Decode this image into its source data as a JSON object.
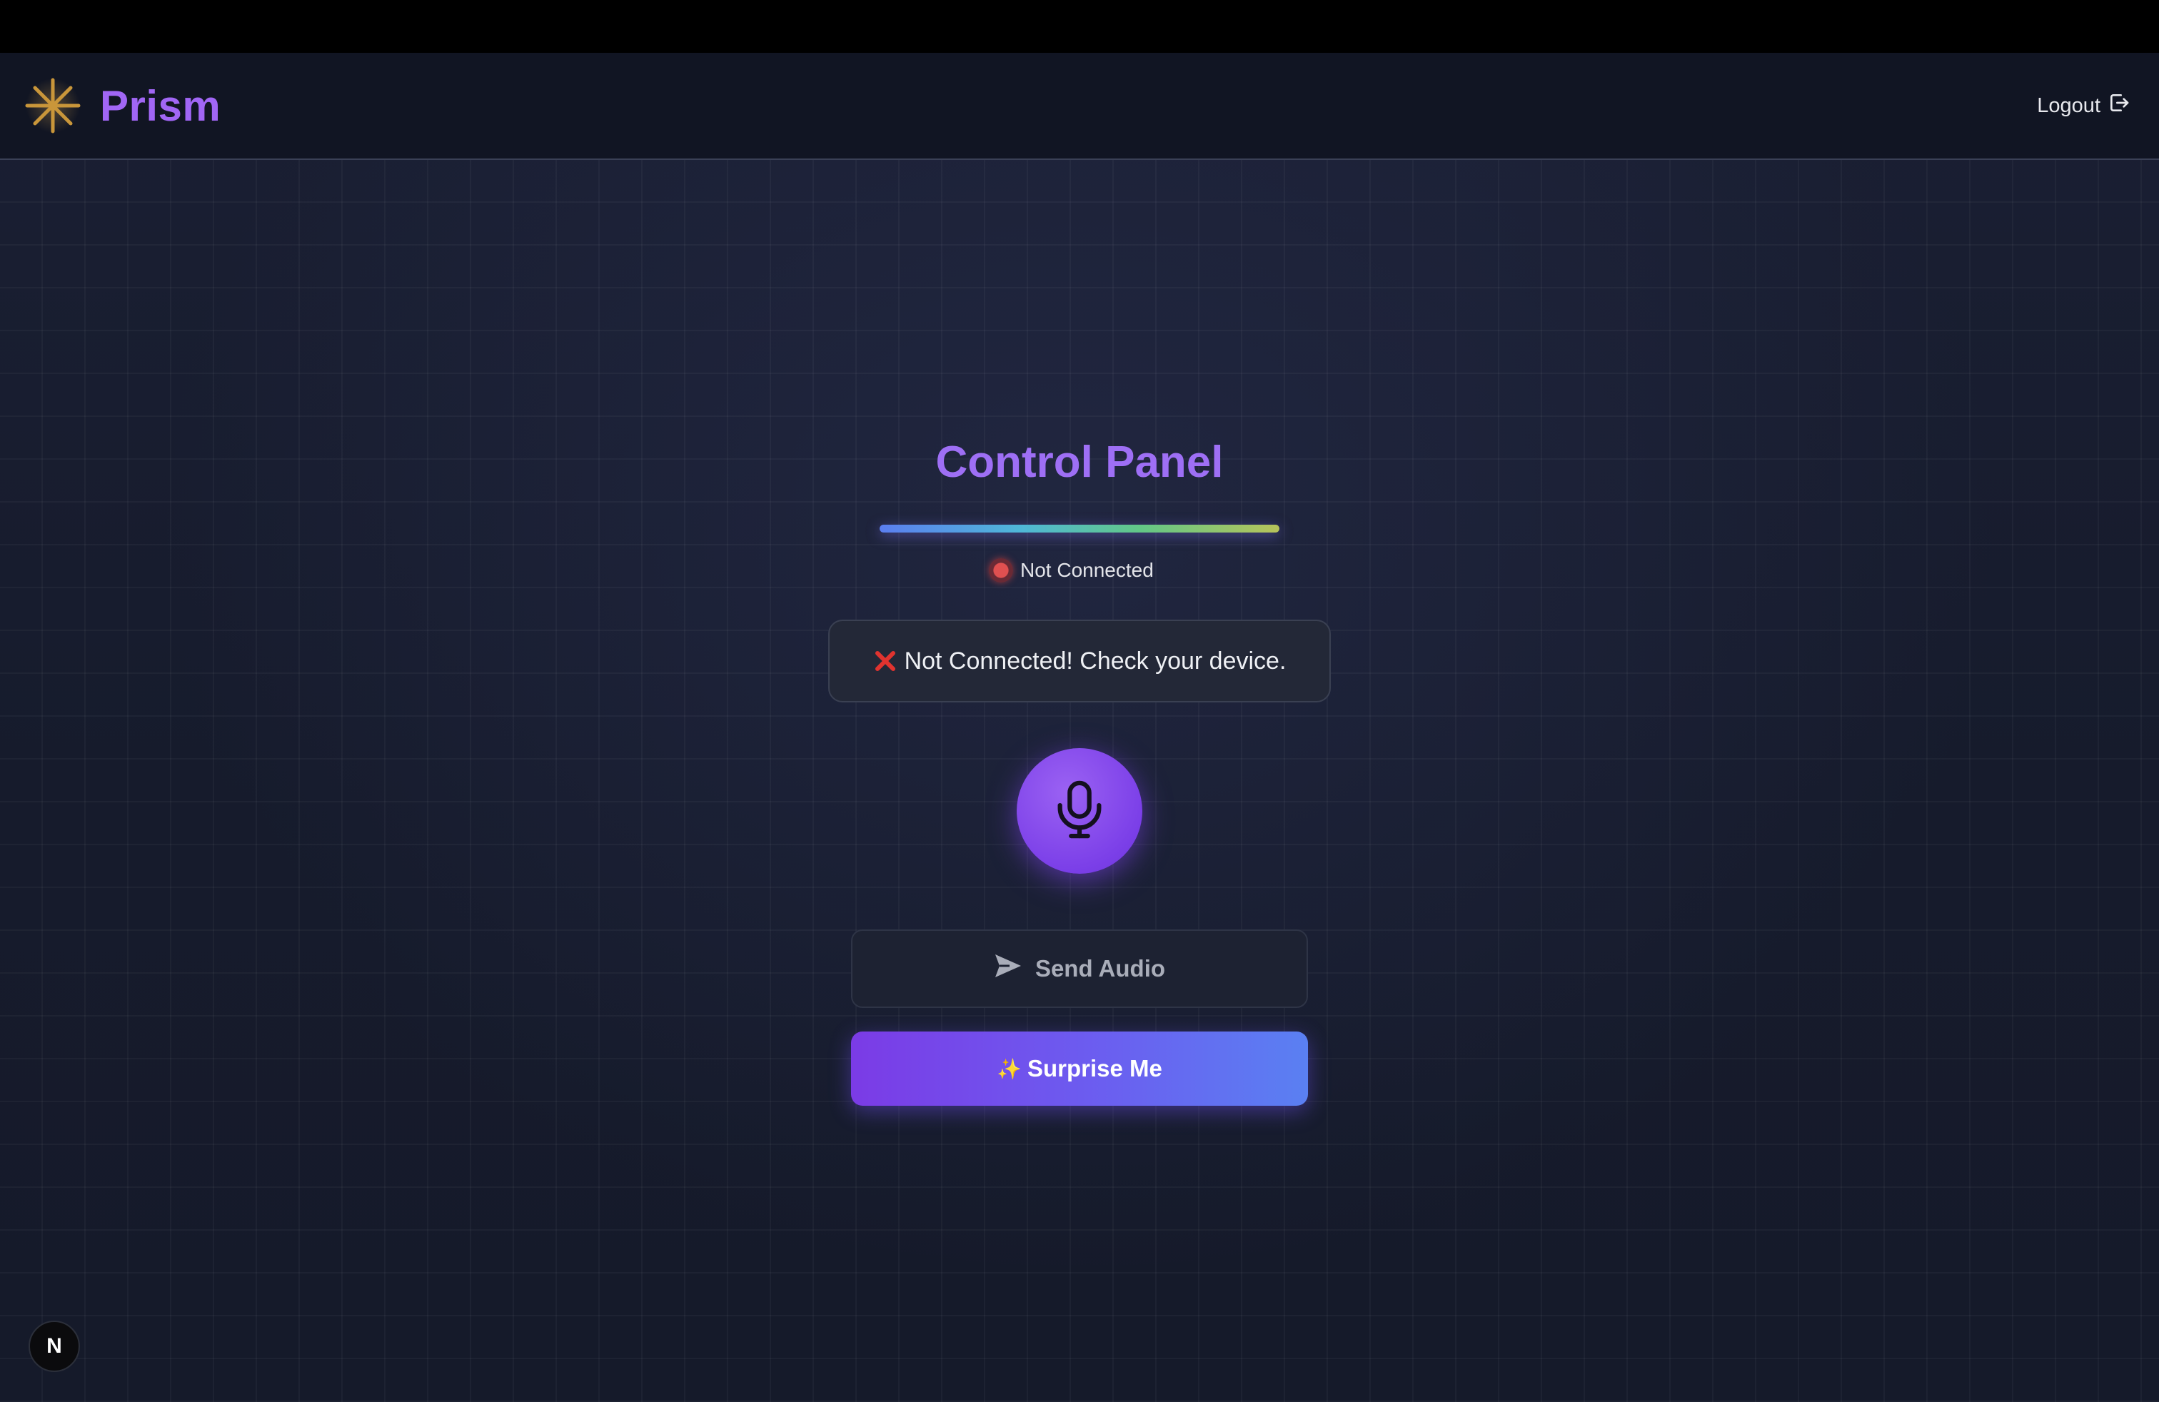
{
  "header": {
    "brand_name": "Prism",
    "logout_label": "Logout"
  },
  "main": {
    "title": "Control Panel",
    "status_text": "Not Connected",
    "alert_text": "Not Connected! Check your device.",
    "send_label": "Send Audio",
    "surprise_label": "Surprise Me"
  },
  "devtools": {
    "badge_letter": "N"
  },
  "icons": {
    "logo": "asterisk-star-icon",
    "logout": "logout-icon",
    "status": "red-dot-icon",
    "alert": "red-x-icon",
    "mic": "microphone-icon",
    "send": "send-arrow-icon",
    "surprise": "sparkles-icon"
  },
  "colors": {
    "accent": "#9e6ff5",
    "brand": "#a166f5",
    "status_error": "#e05050",
    "gradient_start": "#7b3be6",
    "gradient_end": "#5a80f2"
  }
}
